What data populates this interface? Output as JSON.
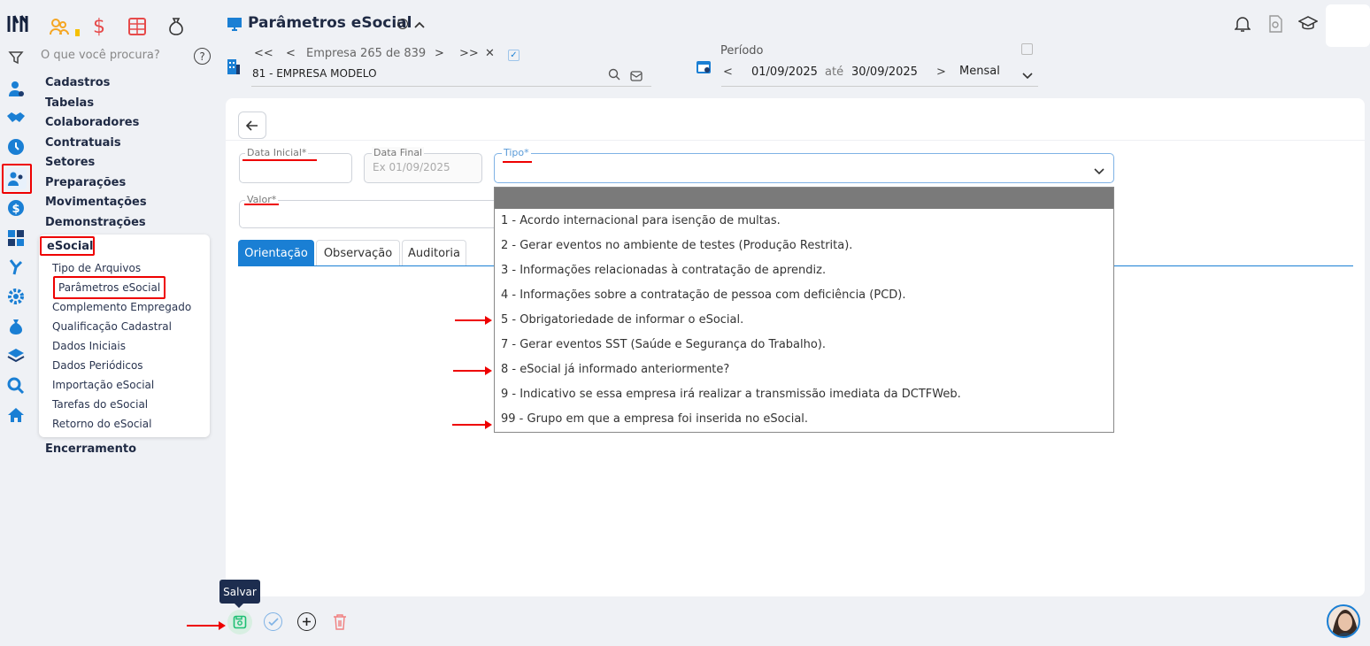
{
  "header": {
    "title": "Parâmetros eSocial",
    "info_icon": "info-icon",
    "collapse_icon": "chevron-up-icon"
  },
  "topbar": {
    "currency_symbol": "$"
  },
  "sidebar": {
    "search_placeholder": "O que você procura?",
    "help": "?",
    "items": [
      {
        "label": "Cadastros"
      },
      {
        "label": "Tabelas"
      },
      {
        "label": "Colaboradores"
      },
      {
        "label": "Contratuais"
      },
      {
        "label": "Setores"
      },
      {
        "label": "Preparações"
      },
      {
        "label": "Movimentações"
      },
      {
        "label": "Demonstrações"
      },
      {
        "label": "eSocial"
      },
      {
        "label": "Encerramento"
      }
    ],
    "submenu": [
      {
        "label": "Tipo de Arquivos"
      },
      {
        "label": "Parâmetros eSocial"
      },
      {
        "label": "Complemento Empregado"
      },
      {
        "label": "Qualificação Cadastral"
      },
      {
        "label": "Dados Iniciais"
      },
      {
        "label": "Dados Periódicos"
      },
      {
        "label": "Importação eSocial"
      },
      {
        "label": "Tarefas do eSocial"
      },
      {
        "label": "Retorno do eSocial"
      }
    ]
  },
  "company": {
    "first": "<<",
    "prev": "<",
    "label": "Empresa 265 de 839",
    "next": ">",
    "last": ">>",
    "close": "✕",
    "check": "✓",
    "name": "81 - EMPRESA MODELO"
  },
  "period": {
    "label": "Período",
    "prev": "<",
    "start": "01/09/2025",
    "until": "até",
    "end": "30/09/2025",
    "next": ">",
    "mode": "Mensal"
  },
  "form": {
    "data_inicial_label": "Data Inicial*",
    "data_final_label": "Data Final",
    "data_final_placeholder": "Ex 01/09/2025",
    "tipo_label": "Tipo*",
    "valor_label": "Valor*"
  },
  "dropdown": {
    "options": [
      {
        "label": "1 - Acordo internacional para isenção de multas."
      },
      {
        "label": "2 - Gerar eventos no ambiente de testes (Produção Restrita)."
      },
      {
        "label": "3 - Informações relacionadas à contratação de aprendiz."
      },
      {
        "label": "4 - Informações sobre a contratação de pessoa com deficiência (PCD)."
      },
      {
        "label": "5 - Obrigatoriedade de informar o eSocial."
      },
      {
        "label": "7 - Gerar eventos SST (Saúde e Segurança do Trabalho)."
      },
      {
        "label": "8 - eSocial já informado anteriormente?"
      },
      {
        "label": "9 - Indicativo se essa empresa irá realizar a transmissão imediata da DCTFWeb."
      },
      {
        "label": "99 - Grupo em que a empresa foi inserida no eSocial."
      }
    ]
  },
  "tabs": [
    {
      "label": "Orientação"
    },
    {
      "label": "Observação"
    },
    {
      "label": "Auditoria"
    }
  ],
  "footer": {
    "tooltip": "Salvar"
  },
  "colors": {
    "accent": "#1a7fd4",
    "annotation": "#e00000",
    "save_green": "#1dbf73",
    "delete_red": "#f08080"
  }
}
